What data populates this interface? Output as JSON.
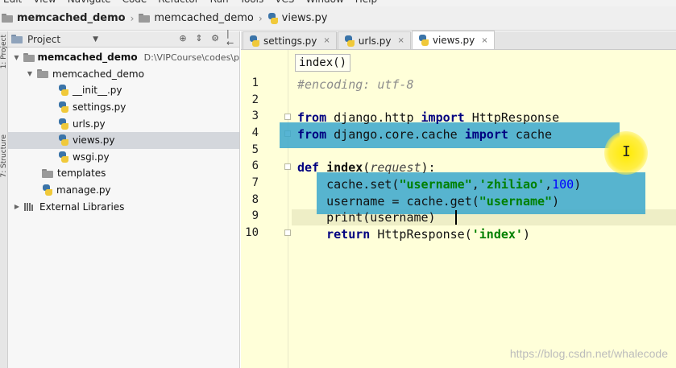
{
  "menu": {
    "items": [
      "Edit",
      "View",
      "Navigate",
      "Code",
      "Refactor",
      "Run",
      "Tools",
      "VCS",
      "Window",
      "Help"
    ]
  },
  "navbar": {
    "crumbs": [
      "memcached_demo",
      "memcached_demo",
      "views.py"
    ]
  },
  "left_strip": {
    "tabs": [
      "1: Project",
      "7: Structure"
    ]
  },
  "project_panel": {
    "title": "Project",
    "dropdown": "▼",
    "tools": [
      "⊕",
      "⇕",
      "⚙",
      "|←"
    ]
  },
  "tree": {
    "root": {
      "label": "memcached_demo",
      "path": "D:\\VIPCourse\\codes\\p"
    },
    "pkg": "memcached_demo",
    "files": [
      "__init__.py",
      "settings.py",
      "urls.py",
      "views.py",
      "wsgi.py"
    ],
    "templates": "templates",
    "manage": "manage.py",
    "external": "External Libraries"
  },
  "tabs": [
    {
      "label": "settings.py",
      "close": "×"
    },
    {
      "label": "urls.py",
      "close": "×"
    },
    {
      "label": "views.py",
      "close": "×"
    }
  ],
  "editor": {
    "breadcrumb": "index()",
    "line_numbers": [
      "1",
      "2",
      "3",
      "4",
      "5",
      "6",
      "7",
      "8",
      "9",
      "10"
    ]
  },
  "code": {
    "l1": "#encoding: utf-8",
    "l3_from": "from",
    "l3_mod": " django.http ",
    "l3_import": "import",
    "l3_name": " HttpResponse",
    "l4_from": "from",
    "l4_mod": " django.core.cache ",
    "l4_import": "import",
    "l4_name": " cache",
    "l6_def": "def",
    "l6_fn": "index",
    "l6_open": "(",
    "l6_param": "request",
    "l6_close": "):",
    "l7_a": "    cache.set(",
    "l7_s1": "\"username\"",
    "l7_b": ",",
    "l7_s2": "'zhiliao'",
    "l7_c": ",",
    "l7_n": "100",
    "l7_d": ")",
    "l8_a": "    username = cache.get(",
    "l8_s": "\"username\"",
    "l8_b": ")",
    "l9": "    print(username)",
    "l10_ret": "return",
    "l10_a": " HttpResponse(",
    "l10_s": "'index'",
    "l10_b": ")"
  },
  "ibeam": "I",
  "watermark": "https://blog.csdn.net/whalecode",
  "colors": {
    "editor_bg": "#ffffd9",
    "selection": "#3aa7cc",
    "keyword": "#000080",
    "string": "#008000",
    "number": "#0000ff",
    "cursor_highlight": "#ffea00"
  }
}
